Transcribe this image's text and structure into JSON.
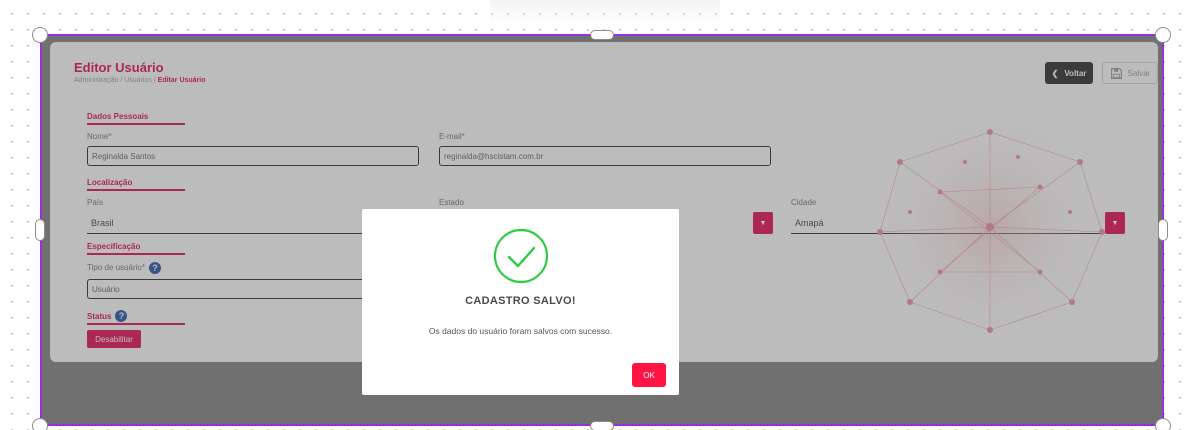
{
  "page": {
    "title": "Editor Usuário",
    "breadcrumb": {
      "path": "Administração / Usuários / ",
      "current": "Editar Usuário"
    }
  },
  "toolbar": {
    "back_label": "Voltar",
    "save_label": "Salvar"
  },
  "sections": {
    "personal": "Dados Pessoais",
    "location": "Localização",
    "specification": "Especificação",
    "status": "Status"
  },
  "fields": {
    "name_label": "Nome*",
    "name_value": "Reginalda Santos",
    "email_label": "E-mail*",
    "email_value": "reginalda@hscistam.com.br",
    "country_label": "País",
    "country_value": "Brasil",
    "state_label": "Estado",
    "city_label": "Cidade",
    "city_value": "Amapá",
    "user_type_label": "Tipo de usuário*",
    "user_type_value": "Usuário"
  },
  "status_button": "Desabilitar",
  "modal": {
    "title": "CADASTRO SALVO!",
    "message": "Os dados do usuário foram salvos com sucesso.",
    "ok_label": "OK"
  },
  "colors": {
    "accent": "#e1004b",
    "selection": "#9a2fe0",
    "success": "#2ecc40"
  }
}
